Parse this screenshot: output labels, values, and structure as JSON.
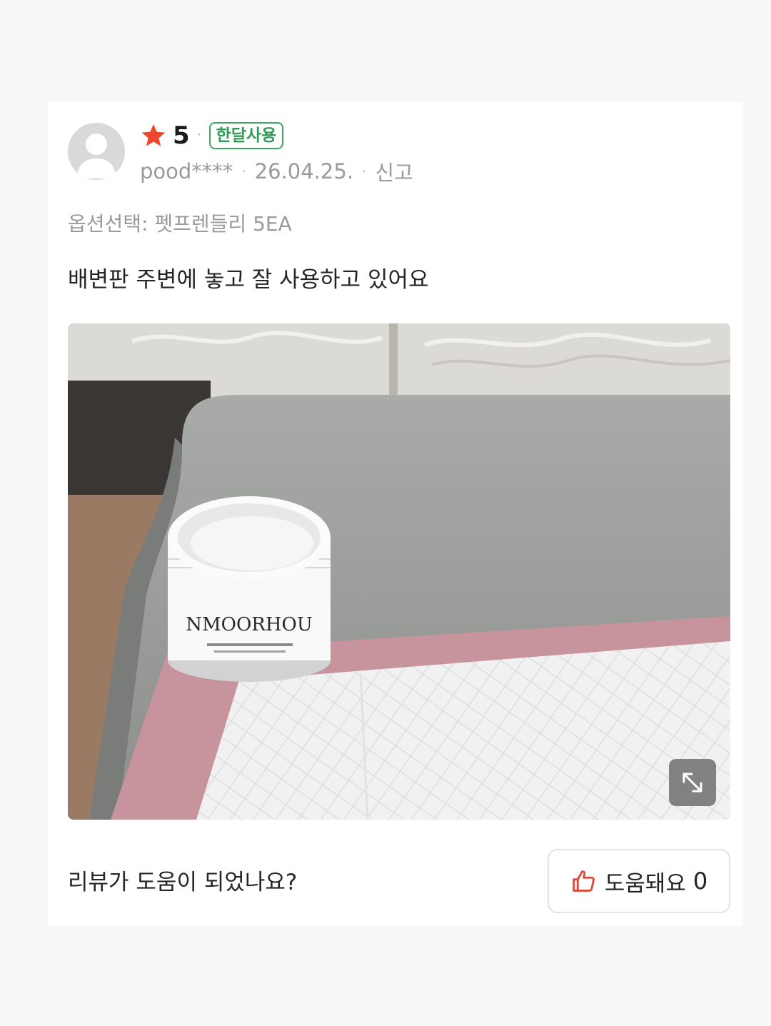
{
  "review": {
    "rating": "5",
    "badge": "한달사용",
    "username": "pood****",
    "date": "26.04.25.",
    "report_label": "신고",
    "option_text": "옵션선택: 펫프렌들리 5EA",
    "content": "배변판 주변에 놓고 잘 사용하고 있어요"
  },
  "photo": {
    "product_logo_text": "NMOORHOU"
  },
  "helpful": {
    "question": "리뷰가 도움이 되었나요?",
    "button_label": "도움돼요",
    "count": "0"
  },
  "colors": {
    "star": "#f0462d",
    "badge_green": "#2e9a52",
    "thumb_red": "#e0483a"
  },
  "icons": {
    "star": "star-icon",
    "avatar": "user-avatar-icon",
    "expand": "expand-icon",
    "thumb": "thumbs-up-icon"
  }
}
